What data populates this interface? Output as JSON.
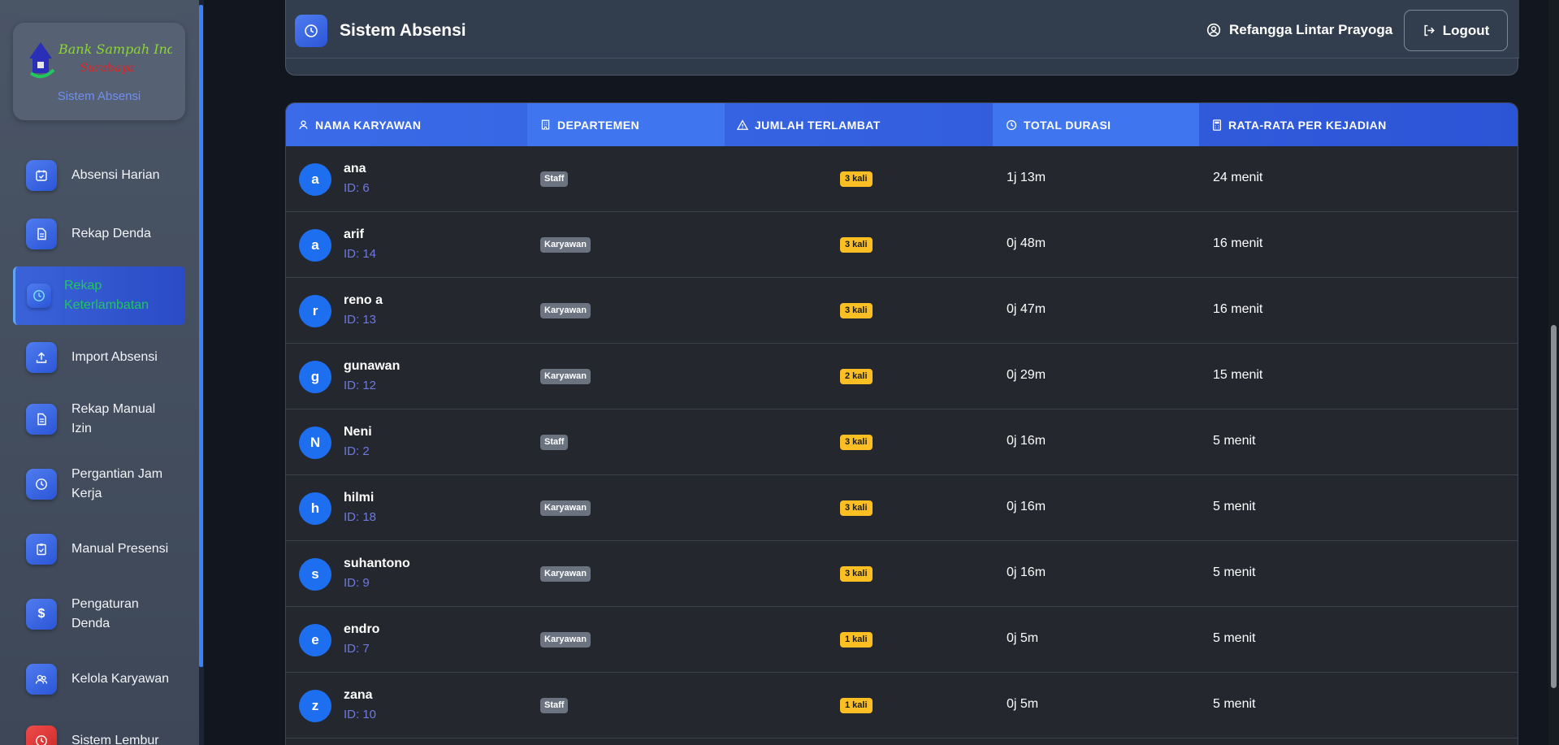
{
  "brand": {
    "logo_text_1": "Bank Sampah Induk",
    "logo_text_2": "Surabaya",
    "subtitle": "Sistem Absensi"
  },
  "sidebar": {
    "items": [
      {
        "label": "Absensi Harian",
        "icon": "calendar-check-icon"
      },
      {
        "label": "Rekap Denda",
        "icon": "document-icon"
      },
      {
        "label": "Rekap Keterlambatan",
        "icon": "clock-icon",
        "active": true
      },
      {
        "label": "Import Absensi",
        "icon": "upload-icon"
      },
      {
        "label": "Rekap Manual Izin",
        "icon": "document-icon"
      },
      {
        "label": "Pergantian Jam Kerja",
        "icon": "clock-icon"
      },
      {
        "label": "Manual Presensi",
        "icon": "clipboard-icon"
      },
      {
        "label": "Pengaturan Denda",
        "icon": "dollar-icon"
      },
      {
        "label": "Kelola Karyawan",
        "icon": "users-icon"
      },
      {
        "label": "Sistem Lembur",
        "icon": "clock-icon"
      }
    ]
  },
  "header": {
    "title": "Sistem Absensi",
    "user_name": "Refangga Lintar Prayoga",
    "logout_label": "Logout"
  },
  "table": {
    "columns": [
      {
        "label": "NAMA KARYAWAN",
        "icon": "user-icon"
      },
      {
        "label": "DEPARTEMEN",
        "icon": "building-icon"
      },
      {
        "label": "JUMLAH TERLAMBAT",
        "icon": "warning-icon"
      },
      {
        "label": "TOTAL DURASI",
        "icon": "clock-icon"
      },
      {
        "label": "RATA-RATA PER KEJADIAN",
        "icon": "calculator-icon"
      }
    ],
    "rows": [
      {
        "initial": "a",
        "name": "ana",
        "id": "ID: 6",
        "dept": "Staff",
        "late": "3 kali",
        "duration": "1j 13m",
        "avg": "24 menit"
      },
      {
        "initial": "a",
        "name": "arif",
        "id": "ID: 14",
        "dept": "Karyawan",
        "late": "3 kali",
        "duration": "0j 48m",
        "avg": "16 menit"
      },
      {
        "initial": "r",
        "name": "reno a",
        "id": "ID: 13",
        "dept": "Karyawan",
        "late": "3 kali",
        "duration": "0j 47m",
        "avg": "16 menit"
      },
      {
        "initial": "g",
        "name": "gunawan",
        "id": "ID: 12",
        "dept": "Karyawan",
        "late": "2 kali",
        "duration": "0j 29m",
        "avg": "15 menit"
      },
      {
        "initial": "N",
        "name": "Neni",
        "id": "ID: 2",
        "dept": "Staff",
        "late": "3 kali",
        "duration": "0j 16m",
        "avg": "5 menit"
      },
      {
        "initial": "h",
        "name": "hilmi",
        "id": "ID: 18",
        "dept": "Karyawan",
        "late": "3 kali",
        "duration": "0j 16m",
        "avg": "5 menit"
      },
      {
        "initial": "s",
        "name": "suhantono",
        "id": "ID: 9",
        "dept": "Karyawan",
        "late": "3 kali",
        "duration": "0j 16m",
        "avg": "5 menit"
      },
      {
        "initial": "e",
        "name": "endro",
        "id": "ID: 7",
        "dept": "Karyawan",
        "late": "1 kali",
        "duration": "0j 5m",
        "avg": "5 menit"
      },
      {
        "initial": "z",
        "name": "zana",
        "id": "ID: 10",
        "dept": "Staff",
        "late": "1 kali",
        "duration": "0j 5m",
        "avg": "5 menit"
      }
    ]
  },
  "colors": {
    "accent": "#3b6be8",
    "active_label": "#22c55e",
    "late_badge": "#fbbf24",
    "dept_badge": "#6b7280",
    "avatar": "#1e6ff0"
  }
}
